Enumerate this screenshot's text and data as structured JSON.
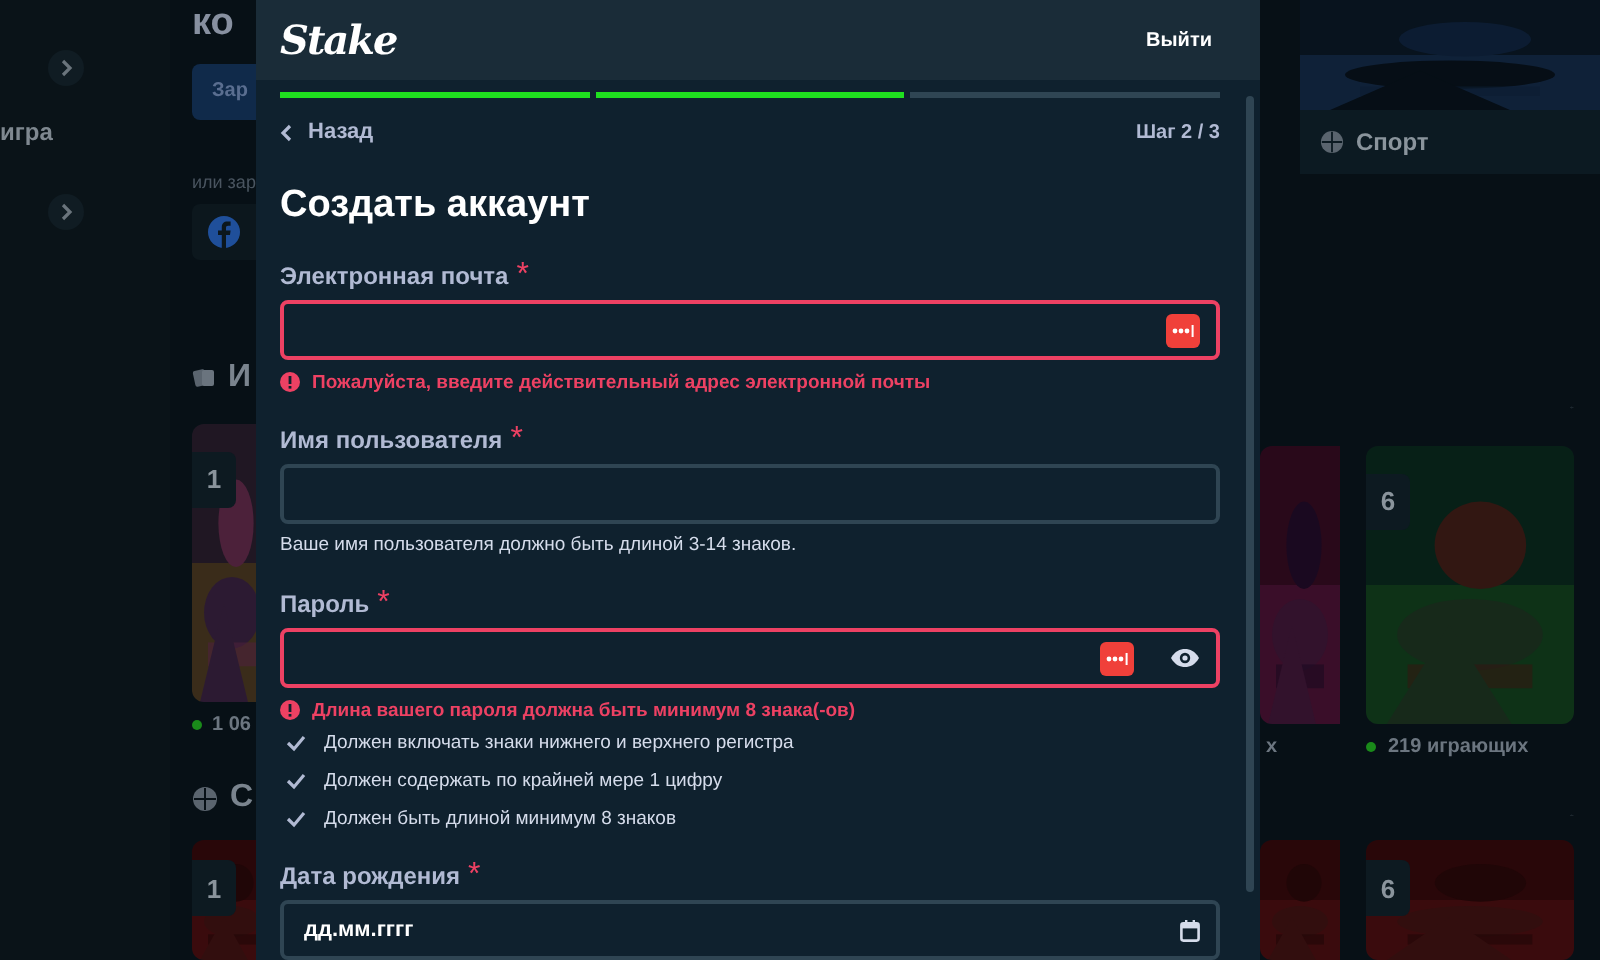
{
  "sidebar": {
    "items": [
      {
        "kind": "chevron"
      },
      {
        "kind": "text",
        "label": "игра"
      },
      {
        "kind": "chevron"
      }
    ]
  },
  "background_left": {
    "heading": "ко",
    "button": "Зар",
    "social_caption": "или зар",
    "section_title": "И",
    "card_rank": "1",
    "card_players": "1 06",
    "section_2_title": "С",
    "card_2_rank": "1"
  },
  "background_right": {
    "banner_label": "Спорт",
    "card_rank": "6",
    "partial_players": "х",
    "card_players": "219 играющих",
    "card_2_rank": "6"
  },
  "modal": {
    "header": {
      "logo": "Stake",
      "logout": "Выйти"
    },
    "progress": [
      {
        "done": true
      },
      {
        "done": true
      },
      {
        "done": false
      }
    ],
    "back": "Назад",
    "step": "Шаг 2 / 3",
    "title": "Создать аккаунт",
    "fields": [
      {
        "kind": "email",
        "label": "Электронная почта",
        "required_mark": "*",
        "invalid": true,
        "error": "Пожалуйста, введите действительный адрес электронной почты"
      },
      {
        "kind": "text",
        "label": "Имя пользователя",
        "required_mark": "*",
        "invalid": false,
        "hint": "Ваше имя пользователя должно быть длиной 3-14 знаков."
      },
      {
        "kind": "password",
        "label": "Пароль",
        "required_mark": "*",
        "invalid": true,
        "error": "Длина вашего пароля должна быть минимум 8 знака(-ов)",
        "checks": [
          {
            "text": "Должен включать знаки нижнего и верхнего регистра",
            "met": true
          },
          {
            "text": "Должен содержать по крайней мере 1 цифру",
            "met": true
          },
          {
            "text": "Должен быть длиной минимум 8 знаков",
            "met": true
          }
        ]
      },
      {
        "kind": "date",
        "label": "Дата рождения",
        "required_mark": "*",
        "invalid": false,
        "placeholder": "дд.мм.гггг"
      }
    ]
  }
}
